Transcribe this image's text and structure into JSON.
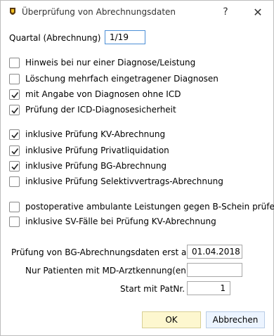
{
  "window": {
    "title": "Überprüfung von Abrechnungsdaten",
    "help_label": "?",
    "close_label": "✕"
  },
  "quartal": {
    "label": "Quartal (Abrechnung)",
    "value": "1/19"
  },
  "checkboxes": [
    {
      "label": "Hinweis bei nur einer Diagnose/Leistung",
      "checked": false
    },
    {
      "label": "Löschung mehrfach eingetragener Diagnosen",
      "checked": false
    },
    {
      "label": "mit Angabe von Diagnosen ohne ICD",
      "checked": true
    },
    {
      "label": "Prüfung der ICD-Diagnosesicherheit",
      "checked": true
    },
    {
      "label": "inklusive Prüfung KV-Abrechnung",
      "checked": true
    },
    {
      "label": "inklusive Prüfung Privatliquidation",
      "checked": true
    },
    {
      "label": "inklusive Prüfung BG-Abrechnung",
      "checked": true
    },
    {
      "label": "inklusive Prüfung Selektivvertrags-Abrechnung",
      "checked": false
    },
    {
      "label": "postoperative ambulante Leistungen gegen B-Schein prüfen",
      "checked": false
    },
    {
      "label": "inklusive SV-Fälle bei Prüfung KV-Abrechnung",
      "checked": false
    }
  ],
  "bg_date": {
    "label": "Prüfung von BG-Abrechnungsdaten erst ab",
    "value": "01.04.2018"
  },
  "md_arzt": {
    "label": "Nur Patienten mit MD-Arztkennung(en)",
    "value": ""
  },
  "start_pat": {
    "label": "Start mit PatNr.",
    "value": "1"
  },
  "buttons": {
    "ok": "OK",
    "cancel": "Abbrechen"
  }
}
